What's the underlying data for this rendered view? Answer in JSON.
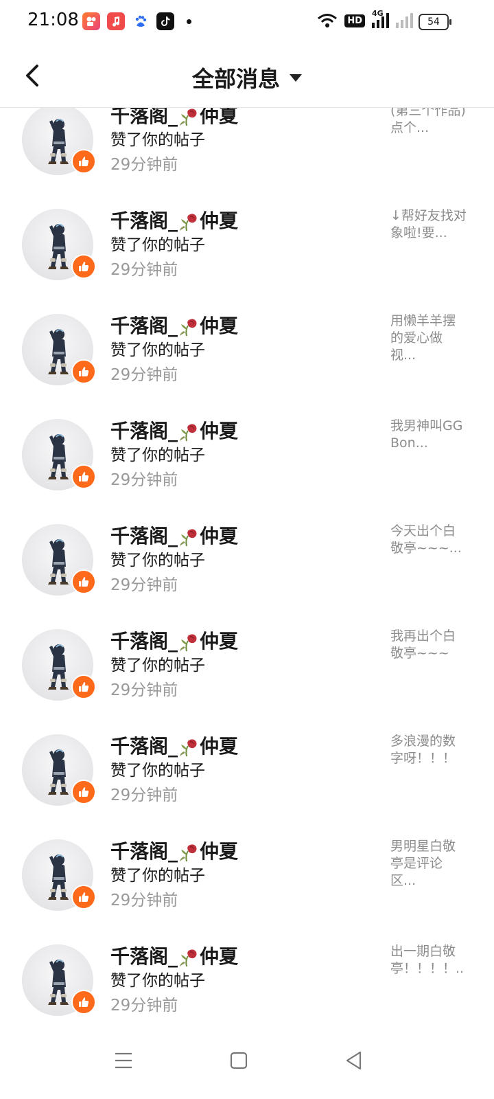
{
  "status_bar": {
    "time": "21:08",
    "network": "4G",
    "hd_label": "HD",
    "battery": "54"
  },
  "header": {
    "title": "全部消息"
  },
  "notifications": [
    {
      "name_left": "千落阁_",
      "name_right": "仲夏",
      "action": "赞了你的帖子",
      "time": "29分钟前",
      "preview": "(第三个作品)点个..."
    },
    {
      "name_left": "千落阁_",
      "name_right": "仲夏",
      "action": "赞了你的帖子",
      "time": "29分钟前",
      "preview": "↓帮好友找对象啦!要..."
    },
    {
      "name_left": "千落阁_",
      "name_right": "仲夏",
      "action": "赞了你的帖子",
      "time": "29分钟前",
      "preview": "用懒羊羊摆的爱心做视..."
    },
    {
      "name_left": "千落阁_",
      "name_right": "仲夏",
      "action": "赞了你的帖子",
      "time": "29分钟前",
      "preview": "我男神叫GG Bon..."
    },
    {
      "name_left": "千落阁_",
      "name_right": "仲夏",
      "action": "赞了你的帖子",
      "time": "29分钟前",
      "preview": "今天出个白敬亭~~~..."
    },
    {
      "name_left": "千落阁_",
      "name_right": "仲夏",
      "action": "赞了你的帖子",
      "time": "29分钟前",
      "preview": "我再出个白敬亭~~~"
    },
    {
      "name_left": "千落阁_",
      "name_right": "仲夏",
      "action": "赞了你的帖子",
      "time": "29分钟前",
      "preview": "多浪漫的数字呀！！！"
    },
    {
      "name_left": "千落阁_",
      "name_right": "仲夏",
      "action": "赞了你的帖子",
      "time": "29分钟前",
      "preview": "男明星白敬亭是评论区..."
    },
    {
      "name_left": "千落阁_",
      "name_right": "仲夏",
      "action": "赞了你的帖子",
      "time": "29分钟前",
      "preview": "出一期白敬亭！！！！.."
    }
  ],
  "icons": {
    "back": "back-arrow-icon",
    "dropdown": "caret-down-icon",
    "like_badge": "thumbs-up-icon",
    "name_emoji": "rose-icon",
    "nav_menu": "menu-icon",
    "nav_home": "home-square-icon",
    "nav_back": "back-triangle-icon"
  },
  "colors": {
    "accent": "#ff6a1a",
    "secondary_text": "#999999",
    "preview_text": "#8c8c8c"
  }
}
